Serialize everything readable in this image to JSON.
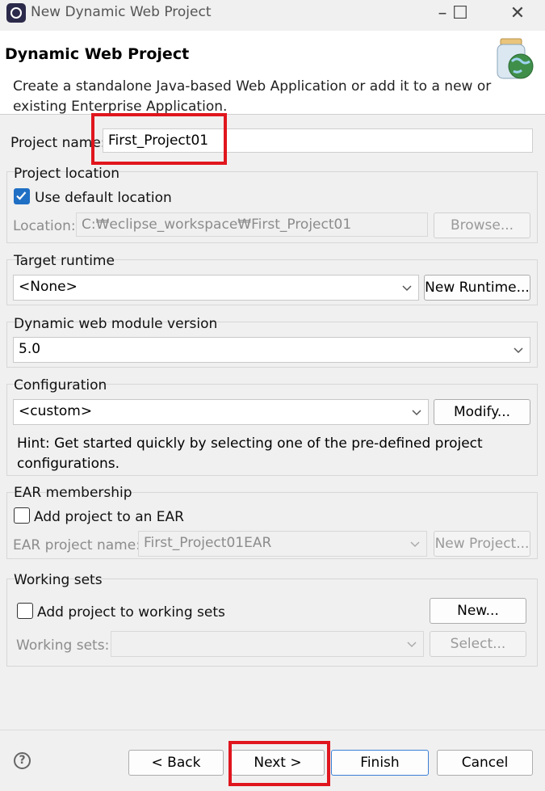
{
  "window": {
    "title": "New Dynamic Web Project",
    "minimize": "–",
    "maximize": "☐",
    "close": "✕"
  },
  "header": {
    "title": "Dynamic Web Project",
    "description": "Create a standalone Java-based Web Application or add it to a new or existing Enterprise Application."
  },
  "project_name": {
    "label": "Project name:",
    "value": "First_Project01"
  },
  "project_location": {
    "group_label": "Project location",
    "use_default_label": "Use default location",
    "use_default_checked": true,
    "location_label": "Location:",
    "location_value": "C:₩eclipse_workspace₩First_Project01",
    "browse_label": "Browse..."
  },
  "target_runtime": {
    "group_label": "Target runtime",
    "selected": "<None>",
    "new_runtime_label": "New Runtime..."
  },
  "module_version": {
    "group_label": "Dynamic web module version",
    "selected": "5.0"
  },
  "configuration": {
    "group_label": "Configuration",
    "selected": "<custom>",
    "modify_label": "Modify...",
    "hint": "Hint: Get started quickly by selecting one of the pre-defined project configurations."
  },
  "ear": {
    "group_label": "EAR membership",
    "add_label": "Add project to an EAR",
    "add_checked": false,
    "name_label": "EAR project name:",
    "name_value": "First_Project01EAR",
    "new_project_label": "New Project..."
  },
  "working_sets": {
    "group_label": "Working sets",
    "add_label": "Add project to working sets",
    "add_checked": false,
    "new_label": "New...",
    "sets_label": "Working sets:",
    "sets_value": "",
    "select_label": "Select..."
  },
  "footer": {
    "help": "?",
    "back_label": "< Back",
    "next_label": "Next >",
    "finish_label": "Finish",
    "cancel_label": "Cancel"
  },
  "colors": {
    "highlight": "#e0161e",
    "checkbox_checked": "#1f6fc4",
    "primary_border": "#3b7ed6"
  }
}
